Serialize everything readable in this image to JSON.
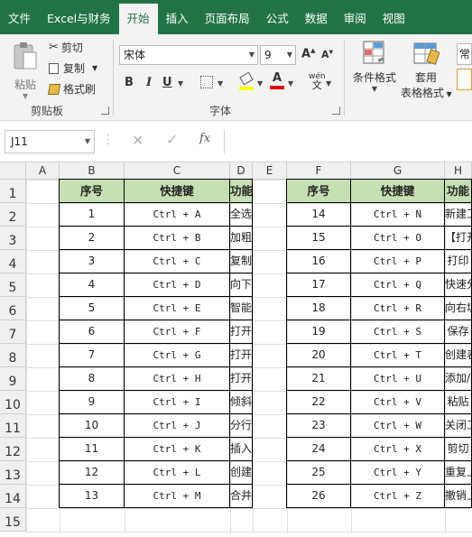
{
  "tabs": [
    "文件",
    "Excel与财务",
    "开始",
    "插入",
    "页面布局",
    "公式",
    "数据",
    "审阅",
    "视图"
  ],
  "active_tab": 2,
  "ribbon": {
    "paste": "粘贴",
    "cut": "剪切",
    "copy": "复制",
    "format_painter": "格式刷",
    "clipboard_label": "剪贴板",
    "font_name": "宋体",
    "font_size": "9",
    "font_label": "字体",
    "bold": "B",
    "italic": "I",
    "underline": "U",
    "phonetic": "wén",
    "cond_format": "条件格式",
    "table_format_1": "套用",
    "table_format_2": "表格格式",
    "style_partial": "常"
  },
  "formula_bar": {
    "name_box": "J11",
    "fx": "fx"
  },
  "columns": [
    "A",
    "B",
    "C",
    "D",
    "E",
    "F",
    "G",
    "H"
  ],
  "rows": [
    "1",
    "2",
    "3",
    "4",
    "5",
    "6",
    "7",
    "8",
    "9",
    "10",
    "11",
    "12",
    "13",
    "14",
    "15"
  ],
  "table_headers": [
    "序号",
    "快捷键",
    "功能"
  ],
  "left_table": [
    [
      "1",
      "Ctrl + A",
      "全选表格"
    ],
    [
      "2",
      "Ctrl + B",
      "加粗/取消加粗字体"
    ],
    [
      "3",
      "Ctrl + C",
      "复制"
    ],
    [
      "4",
      "Ctrl + D",
      "向下填充"
    ],
    [
      "5",
      "Ctrl + E",
      "智能填充"
    ],
    [
      "6",
      "Ctrl + F",
      "打开查找窗口"
    ],
    [
      "7",
      "Ctrl + G",
      "打开定位窗口"
    ],
    [
      "8",
      "Ctrl + H",
      "打开替换窗口"
    ],
    [
      "9",
      "Ctrl + I",
      "倾斜/取消倾斜字体"
    ],
    [
      "10",
      "Ctrl + J",
      "分行功能"
    ],
    [
      "11",
      "Ctrl + K",
      "插入超链接"
    ],
    [
      "12",
      "Ctrl + L",
      "创建表"
    ],
    [
      "13",
      "Ctrl + M",
      "合并后居中"
    ]
  ],
  "right_table": [
    [
      "14",
      "Ctrl + N",
      "新建工作簿"
    ],
    [
      "15",
      "Ctrl + O",
      "【打开】窗口"
    ],
    [
      "16",
      "Ctrl + P",
      "打印"
    ],
    [
      "17",
      "Ctrl + Q",
      "快速分析"
    ],
    [
      "18",
      "Ctrl + R",
      "向右填充"
    ],
    [
      "19",
      "Ctrl + S",
      "保存"
    ],
    [
      "20",
      "Ctrl + T",
      "创建表"
    ],
    [
      "21",
      "Ctrl + U",
      "添加/取消下划线"
    ],
    [
      "22",
      "Ctrl + V",
      "粘贴"
    ],
    [
      "23",
      "Ctrl + W",
      "关闭工作簿"
    ],
    [
      "24",
      "Ctrl + X",
      "剪切"
    ],
    [
      "25",
      "Ctrl + Y",
      "重复上一步操作"
    ],
    [
      "26",
      "Ctrl + Z",
      "撤销上一步操作"
    ]
  ],
  "colors": {
    "title_bar": "#217346",
    "header_fill": "#c6e0b4",
    "font_color_underline": "#e00000",
    "highlight_underline": "#ffff00"
  }
}
